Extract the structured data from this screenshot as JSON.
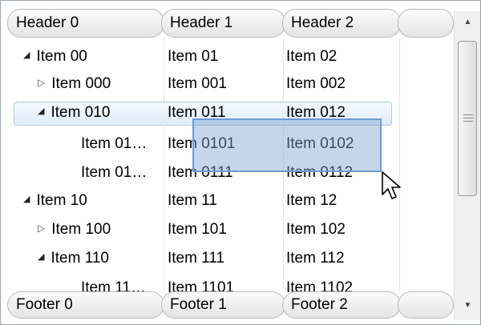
{
  "headers": [
    "Header 0",
    "Header 1",
    "Header 2",
    ""
  ],
  "footers": [
    "Footer 0",
    "Footer 1",
    "Footer 2",
    ""
  ],
  "rows": [
    {
      "expander": "open",
      "c0": "Item 00",
      "c1": "Item 01",
      "c2": "Item 02"
    },
    {
      "expander": "closed",
      "c0": "Item 000",
      "c1": "Item 001",
      "c2": "Item 002"
    },
    {
      "expander": "open",
      "c0": "Item 010",
      "c1": "Item 011",
      "c2": "Item 012",
      "selected": true
    },
    {
      "expander": "none",
      "c0": "Item 01…",
      "c1": "Item 0101",
      "c2": "Item 0102"
    },
    {
      "expander": "none",
      "c0": "Item 01…",
      "c1": "Item 0111",
      "c2": "Item 0112"
    },
    {
      "expander": "open",
      "c0": "Item 10",
      "c1": "Item 11",
      "c2": "Item 12"
    },
    {
      "expander": "closed",
      "c0": "Item 100",
      "c1": "Item 101",
      "c2": "Item 102"
    },
    {
      "expander": "open",
      "c0": "Item 110",
      "c1": "Item 111",
      "c2": "Item 112"
    },
    {
      "expander": "none",
      "c0": "Item 11…",
      "c1": "Item 1101",
      "c2": "Item 1102"
    }
  ],
  "icons": {
    "expanded": "triangle-down-right-icon",
    "collapsed": "triangle-right-outline-icon",
    "scroll_up": "scroll-up-arrow-icon",
    "scroll_down": "scroll-down-arrow-icon",
    "cursor": "mouse-pointer-icon"
  },
  "colors": {
    "selection_border": "#7aa0cc",
    "drag_fill": "#80a3d0",
    "drag_border": "#6f9ad0",
    "header_bg": "#ececec"
  }
}
